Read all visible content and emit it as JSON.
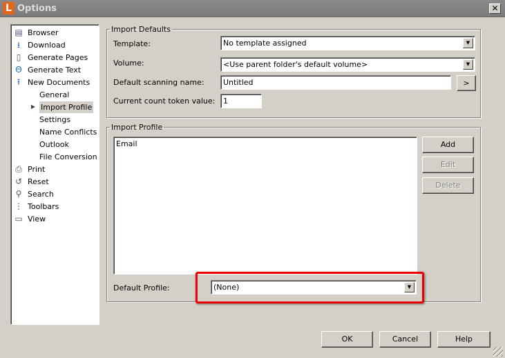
{
  "window": {
    "title": "Options",
    "app_icon_letter": "L",
    "close_label": "✕"
  },
  "tree": {
    "items": [
      {
        "label": "Browser",
        "icon": "browser-icon"
      },
      {
        "label": "Download",
        "icon": "download-icon"
      },
      {
        "label": "Generate Pages",
        "icon": "generate-pages-icon"
      },
      {
        "label": "Generate Text",
        "icon": "generate-text-icon"
      },
      {
        "label": "New Documents",
        "icon": "new-documents-icon"
      },
      {
        "label": "General"
      },
      {
        "label": "Import Profile",
        "selected": true
      },
      {
        "label": "Settings"
      },
      {
        "label": "Name Conflicts"
      },
      {
        "label": "Outlook"
      },
      {
        "label": "File Conversion"
      },
      {
        "label": "Print",
        "icon": "print-icon"
      },
      {
        "label": "Reset",
        "icon": "reset-icon"
      },
      {
        "label": "Search",
        "icon": "search-icon"
      },
      {
        "label": "Toolbars",
        "icon": "toolbars-icon"
      },
      {
        "label": "View",
        "icon": "view-icon"
      }
    ]
  },
  "import_defaults": {
    "legend": "Import Defaults",
    "template_label": "Template:",
    "template_value": "No template assigned",
    "volume_label": "Volume:",
    "volume_value": "<Use parent folder's default volume>",
    "scan_name_label": "Default scanning name:",
    "scan_name_value": "Untitled",
    "scan_name_button": ">",
    "count_label": "Current count token value:",
    "count_value": "1"
  },
  "import_profile": {
    "legend": "Import Profile",
    "profiles": [
      "Email"
    ],
    "add": "Add",
    "edit": "Edit",
    "delete": "Delete",
    "default_label": "Default Profile:",
    "default_value": "(None)"
  },
  "footer": {
    "ok": "OK",
    "cancel": "Cancel",
    "help": "Help"
  },
  "colors": {
    "highlight": "#ee0000",
    "app_icon": "#e0661c"
  }
}
